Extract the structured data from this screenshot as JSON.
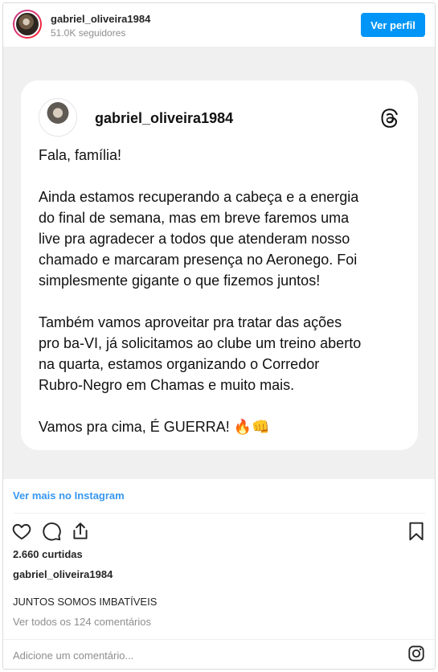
{
  "header": {
    "username": "gabriel_oliveira1984",
    "followers": "51.0K seguidores",
    "follow_label": "Ver perfil"
  },
  "card": {
    "username": "gabriel_oliveira1984",
    "paragraphs": [
      "Fala, família!",
      "Ainda estamos recuperando a cabeça e a energia\ndo final de semana, mas em breve faremos uma\nlive pra agradecer a todos que atenderam nosso\nchamado e marcaram presença no Aeronego. Foi\nsimplesmente gigante o que fizemos juntos!",
      "Também vamos aproveitar pra tratar das ações\npro ba-VI, já solicitamos ao clube um treino aberto\nna quarta, estamos organizando o Corredor\nRubro-Negro em Chamas e muito mais.",
      "Vamos pra cima, É GUERRA! 🔥👊"
    ]
  },
  "footer": {
    "see_more": "Ver mais no Instagram",
    "likes": "2.660 curtidas",
    "caption_user": "gabriel_oliveira1984",
    "caption": "JUNTOS SOMOS IMBATÍVEIS",
    "comments": "Ver todos os 124 comentários",
    "add_comment": "Adicione um comentário..."
  },
  "icons": [
    "heart-icon",
    "comment-icon",
    "share-icon",
    "bookmark-icon",
    "threads-icon",
    "instagram-icon"
  ],
  "colors": {
    "accent": "#0095f6",
    "link": "#3897f0"
  }
}
